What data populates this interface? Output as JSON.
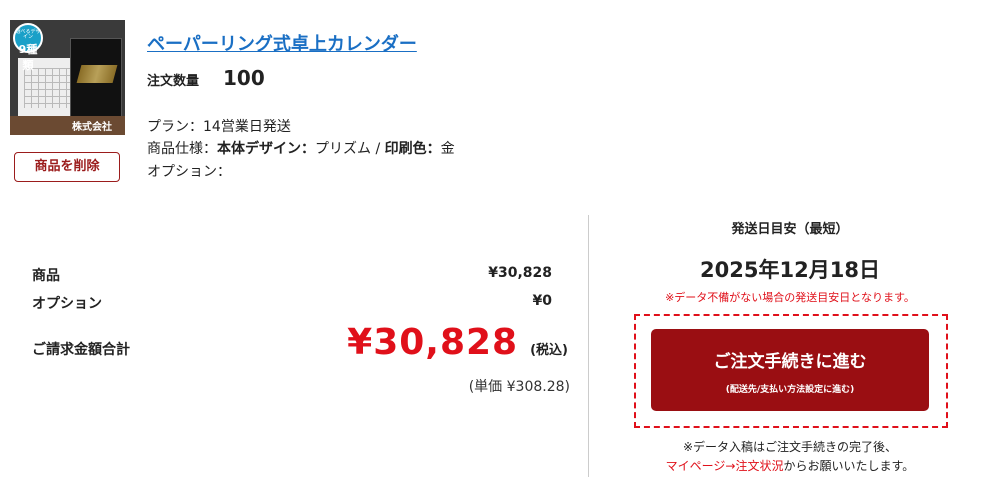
{
  "product": {
    "title": "ペーパーリング式卓上カレンダー",
    "qty_label": "注文数量",
    "qty_value": "100",
    "plan_label": "プラン：",
    "plan_value": "14営業日発送",
    "spec_label": "商品仕様：",
    "spec_body_label": "本体デザイン：",
    "spec_body_value": "プリズム",
    "spec_sep": " / ",
    "spec_color_label": "印刷色：",
    "spec_color_value": "金",
    "option_label": "オプション：",
    "delete_label": "商品を削除",
    "thumb_badge_small": "選べるデザイン",
    "thumb_badge_big": "9種類",
    "thumb_brand": "株式会社"
  },
  "summary": {
    "item_label": "商品",
    "item_value": "¥30,828",
    "option_label": "オプション",
    "option_value": "¥0",
    "total_label": "ご請求金額合計",
    "total_value": "¥30,828",
    "tax_label": "(税込)",
    "unit_price": "(単価 ¥308.28)"
  },
  "shipping": {
    "heading": "発送日目安（最短）",
    "date": "2025年12月18日",
    "note": "※データ不備がない場合の発送目安日となります。",
    "cta_label": "ご注文手続きに進む",
    "cta_sub": "(配送先/支払い方法設定に進む)",
    "after_note_1": "※データ入稿はご注文手続きの完了後、",
    "after_link": "マイページ→注文状況",
    "after_note_2": "からお願いいたします。"
  },
  "colors": {
    "accent_red": "#e0101a",
    "cta_bg": "#9a0e12",
    "link_blue": "#1a6fc4"
  }
}
